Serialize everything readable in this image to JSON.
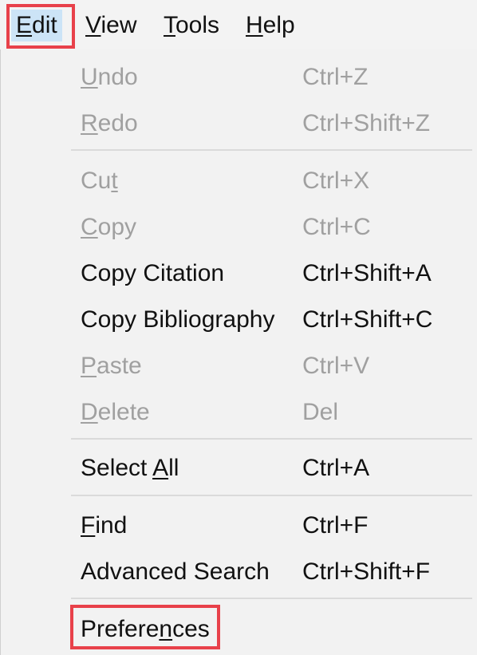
{
  "menubar": {
    "items": [
      {
        "pre": "",
        "u": "E",
        "post": "dit"
      },
      {
        "pre": "",
        "u": "V",
        "post": "iew"
      },
      {
        "pre": "",
        "u": "T",
        "post": "ools"
      },
      {
        "pre": "",
        "u": "H",
        "post": "elp"
      }
    ],
    "active_index": 0
  },
  "menu": {
    "items": [
      {
        "pre": "",
        "u": "U",
        "post": "ndo",
        "shortcut": "Ctrl+Z",
        "enabled": false
      },
      {
        "pre": "",
        "u": "R",
        "post": "edo",
        "shortcut": "Ctrl+Shift+Z",
        "enabled": false
      },
      {
        "pre": "Cu",
        "u": "t",
        "post": "",
        "shortcut": "Ctrl+X",
        "enabled": false
      },
      {
        "pre": "",
        "u": "C",
        "post": "opy",
        "shortcut": "Ctrl+C",
        "enabled": false
      },
      {
        "pre": "Copy Citation",
        "u": "",
        "post": "",
        "shortcut": "Ctrl+Shift+A",
        "enabled": true
      },
      {
        "pre": "Copy Bibliography",
        "u": "",
        "post": "",
        "shortcut": "Ctrl+Shift+C",
        "enabled": true
      },
      {
        "pre": "",
        "u": "P",
        "post": "aste",
        "shortcut": "Ctrl+V",
        "enabled": false
      },
      {
        "pre": "",
        "u": "D",
        "post": "elete",
        "shortcut": "Del",
        "enabled": false
      },
      {
        "pre": "Select ",
        "u": "A",
        "post": "ll",
        "shortcut": "Ctrl+A",
        "enabled": true
      },
      {
        "pre": "",
        "u": "F",
        "post": "ind",
        "shortcut": "Ctrl+F",
        "enabled": true
      },
      {
        "pre": "Advanced Search",
        "u": "",
        "post": "",
        "shortcut": "Ctrl+Shift+F",
        "enabled": true
      },
      {
        "pre": "Prefere",
        "u": "n",
        "post": "ces",
        "shortcut": "",
        "enabled": true
      }
    ]
  },
  "colors": {
    "highlight": "#e8414a",
    "active_menu_bg": "#cce4f7",
    "disabled_text": "#a0a0a0",
    "enabled_text": "#111111"
  }
}
